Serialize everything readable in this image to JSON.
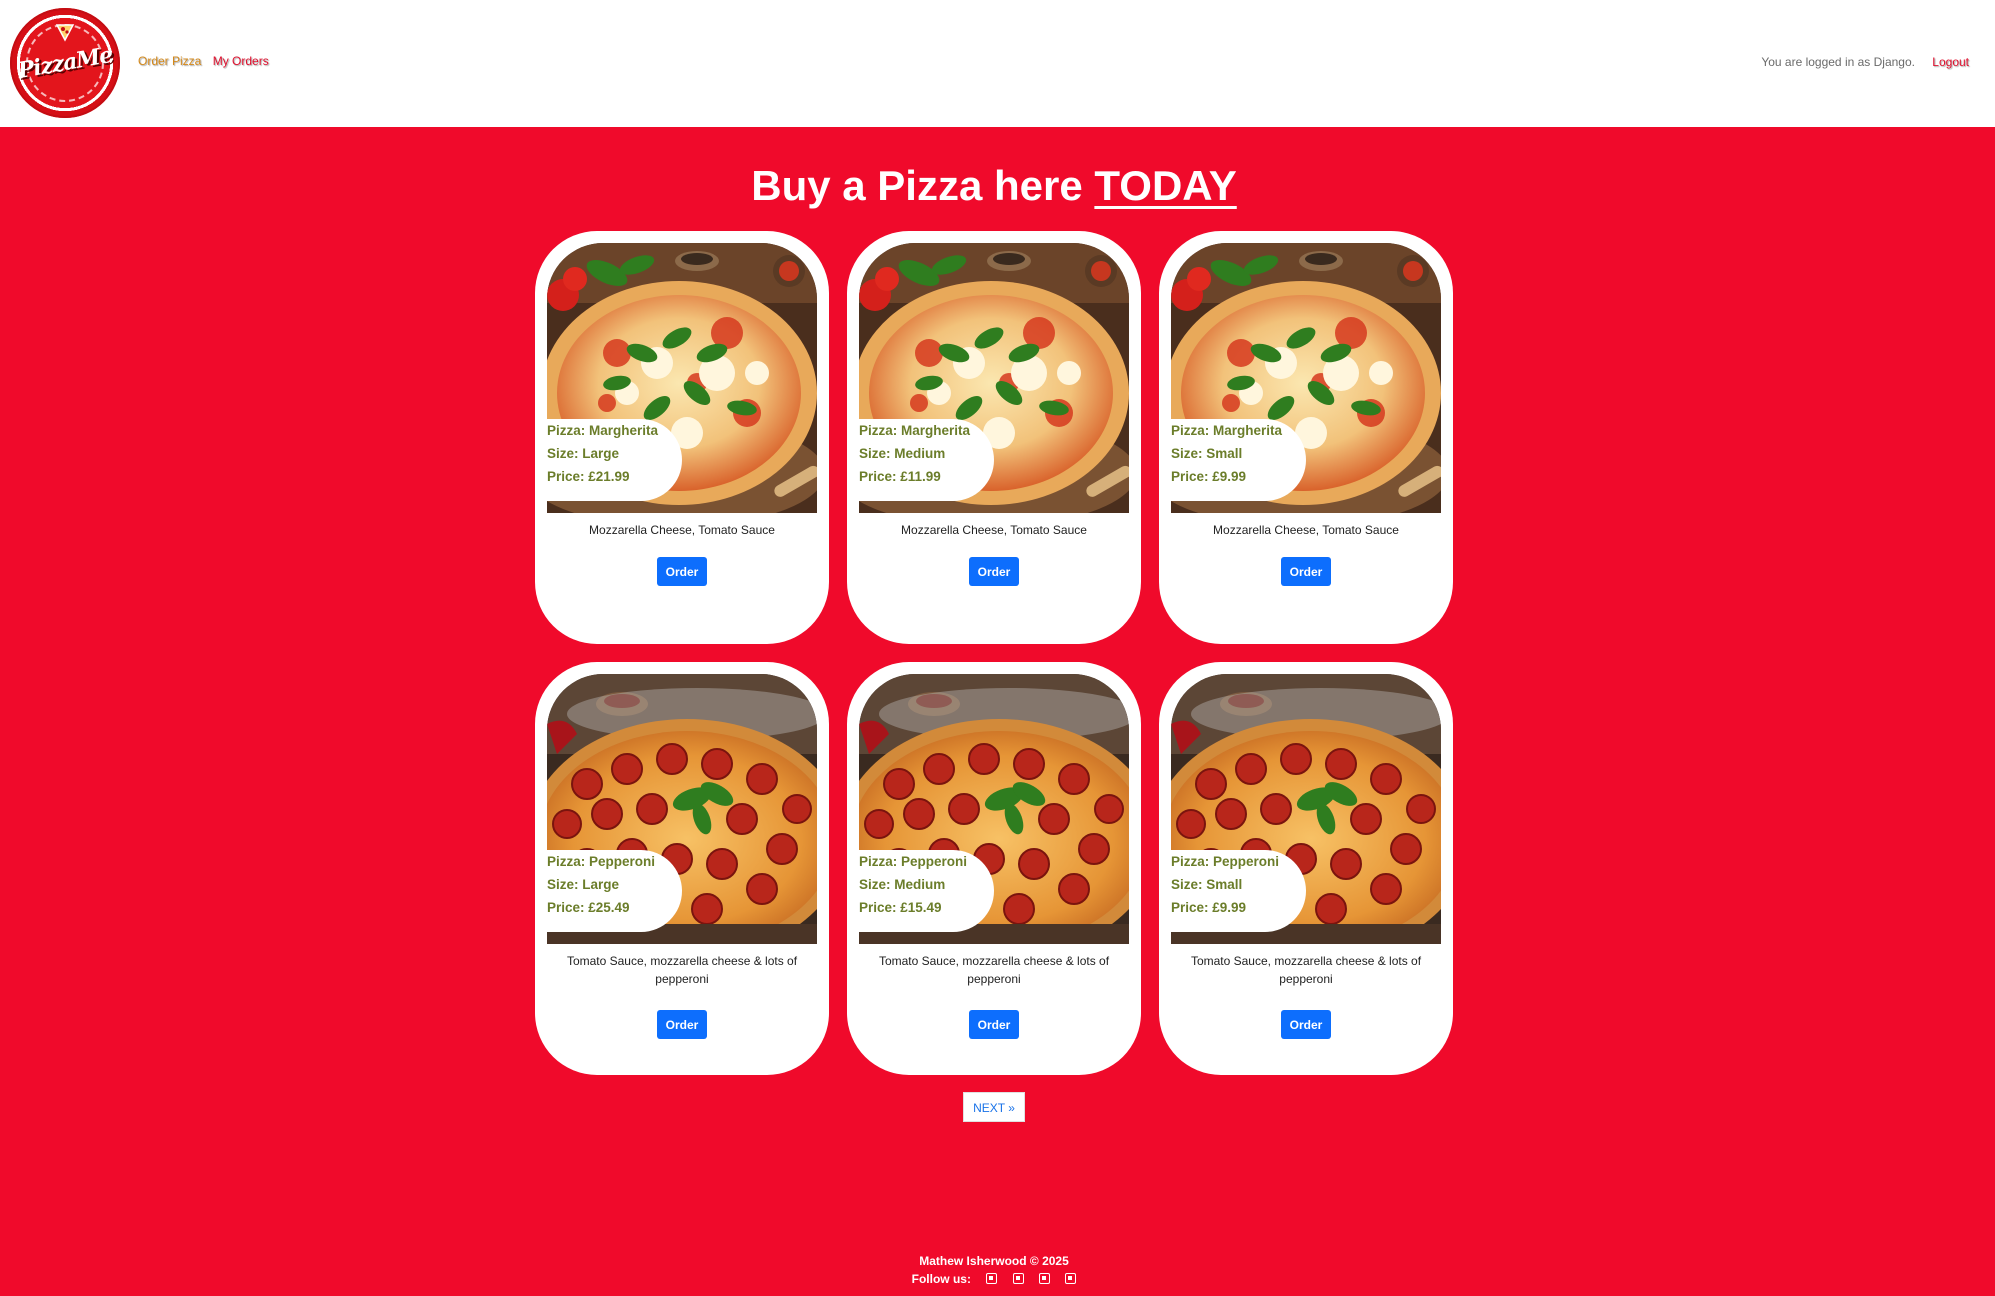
{
  "header": {
    "logo_text": "PizzaMe",
    "nav": {
      "order_pizza": "Order Pizza",
      "my_orders": "My Orders"
    },
    "login_status": "You are logged in as Django.",
    "logout": "Logout"
  },
  "main": {
    "title": "Buy a Pizza here",
    "title_emphasis": "TODAY"
  },
  "cards": [
    {
      "pizza": "Pizza: Margherita",
      "size": "Size: Large",
      "price": "Price: £21.99",
      "description": "Mozzarella Cheese, Tomato Sauce",
      "button": "Order",
      "image": "margherita"
    },
    {
      "pizza": "Pizza: Margherita",
      "size": "Size: Medium",
      "price": "Price: £11.99",
      "description": "Mozzarella Cheese, Tomato Sauce",
      "button": "Order",
      "image": "margherita"
    },
    {
      "pizza": "Pizza: Margherita",
      "size": "Size: Small",
      "price": "Price: £9.99",
      "description": "Mozzarella Cheese, Tomato Sauce",
      "button": "Order",
      "image": "margherita"
    },
    {
      "pizza": "Pizza: Pepperoni",
      "size": "Size: Large",
      "price": "Price: £25.49",
      "description": "Tomato Sauce, mozzarella cheese & lots of pepperoni",
      "button": "Order",
      "image": "pepperoni"
    },
    {
      "pizza": "Pizza: Pepperoni",
      "size": "Size: Medium",
      "price": "Price: £15.49",
      "description": "Tomato Sauce, mozzarella cheese & lots of pepperoni",
      "button": "Order",
      "image": "pepperoni"
    },
    {
      "pizza": "Pizza: Pepperoni",
      "size": "Size: Small",
      "price": "Price: £9.99",
      "description": "Tomato Sauce, mozzarella cheese & lots of pepperoni",
      "button": "Order",
      "image": "pepperoni"
    }
  ],
  "pagination": {
    "next": "NEXT »"
  },
  "footer": {
    "copyright": "Mathew Isherwood © 2025",
    "follow_us": "Follow us:",
    "social_icons": [
      "facebook-icon",
      "twitter-icon",
      "instagram-icon",
      "youtube-icon"
    ]
  },
  "colors": {
    "background": "#f00a2b",
    "order_button": "#0d6efd",
    "info_text": "#6b7d2a",
    "nav_order": "#d4891b",
    "nav_orders": "#e0102e"
  }
}
